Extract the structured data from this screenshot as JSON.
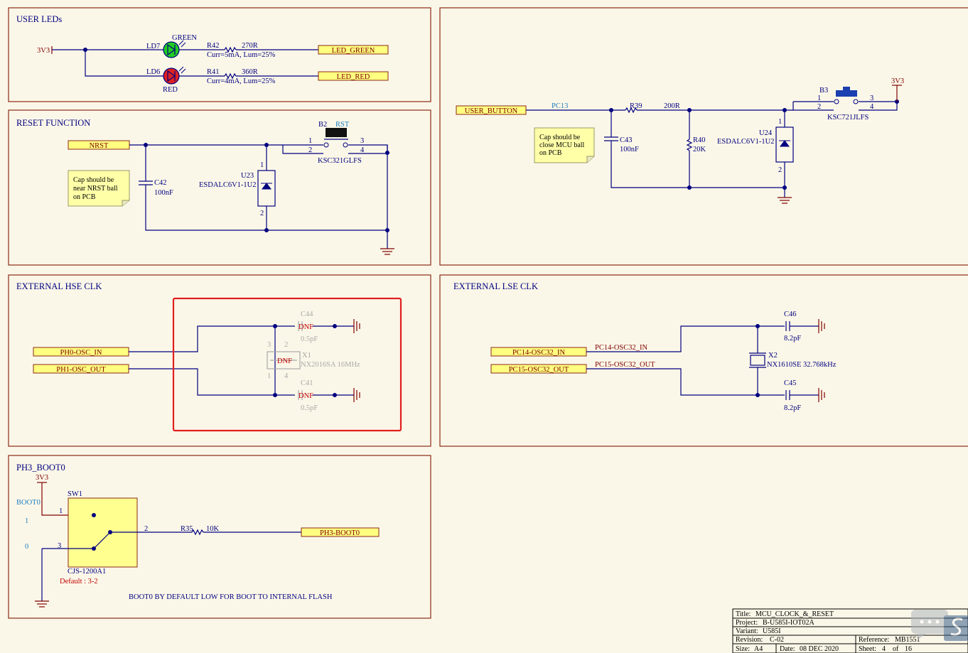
{
  "sections": {
    "user_leds": "USER LEDs",
    "reset_function": "RESET FUNCTION",
    "external_hse": "EXTERNAL HSE CLK",
    "external_lse": "EXTERNAL LSE CLK",
    "ph3_boot0": "PH3_BOOT0"
  },
  "power": {
    "v3v3": "3V3"
  },
  "leds": {
    "ld7": {
      "ref": "LD7",
      "color": "GREEN",
      "res_ref": "R42",
      "res_val": "270R",
      "res_note": "Curr=5mA, Lum=25%",
      "net": "LED_GREEN",
      "fill": "#22cc22"
    },
    "ld6": {
      "ref": "LD6",
      "color": "RED",
      "res_ref": "R41",
      "res_val": "360R",
      "res_note": "Curr=4mA, Lum=25%",
      "net": "LED_RED",
      "fill": "#dd2222"
    }
  },
  "reset": {
    "net": "NRST",
    "note": [
      "Cap should be",
      "near NRST ball",
      "on PCB"
    ],
    "cap_ref": "C42",
    "cap_val": "100nF",
    "tvs_ref": "U23",
    "tvs_val": "ESDALC6V1-1U2",
    "tvs_pin1": "1",
    "tvs_pin2": "2",
    "btn_ref": "B2",
    "btn_label": "RST",
    "btn_val": "KSC321GLFS",
    "p1": "1",
    "p2": "2",
    "p3": "3",
    "p4": "4"
  },
  "user_button": {
    "net": "USER_BUTTON",
    "pin": "PC13",
    "note": [
      "Cap should be",
      "close MCU ball",
      "on PCB"
    ],
    "cap_ref": "C43",
    "cap_val": "100nF",
    "r1_ref": "R39",
    "r1_val": "200R",
    "r2_ref": "R40",
    "r2_val": "20K",
    "tvs_ref": "U24",
    "tvs_val": "ESDALC6V1-1U2",
    "tvs_pin1": "1",
    "tvs_pin2": "2",
    "btn_ref": "B3",
    "btn_val": "KSC721JLFS",
    "p1": "1",
    "p2": "2",
    "p3": "3",
    "p4": "4"
  },
  "hse": {
    "net_in": "PH0-OSC_IN",
    "net_out": "PH1-OSC_OUT",
    "c44_ref": "C44",
    "c44_val": "0.5pF",
    "c41_ref": "C41",
    "c41_val": "0.5pF",
    "dnf": "DNF",
    "x1_ref": "X1",
    "x1_val": "NX2016SA 16MHz",
    "xp1": "1",
    "xp2": "2",
    "xp3": "3",
    "xp4": "4",
    "highlight": "#e02020"
  },
  "lse": {
    "net_in": "PC14-OSC32_IN",
    "net_out": "PC15-OSC32_OUT",
    "c46_ref": "C46",
    "c46_val": "8.2pF",
    "c45_ref": "C45",
    "c45_val": "8.2pF",
    "x2_ref": "X2",
    "x2_val": "NX1610SE 32.768kHz"
  },
  "boot": {
    "boot_label": "BOOT0",
    "one": "1",
    "zero": "0",
    "sw_ref": "SW1",
    "sw_val": "CJS-1200A1",
    "default_note": "Default : 3-2",
    "pin1": "1",
    "pin2": "2",
    "pin3": "3",
    "res_ref": "R35",
    "res_val": "10K",
    "net": "PH3-BOOT0",
    "caption": "BOOT0 BY DEFAULT LOW FOR BOOT TO INTERNAL FLASH"
  },
  "title_block": {
    "title_k": "Title:",
    "title_v": "MCU_CLOCK_&_RESET",
    "project_k": "Project:",
    "project_v": "B-U585I-IOT02A",
    "variant_k": "Variant:",
    "variant_v": "U585I",
    "revision_k": "Revision:",
    "revision_v": "C-02",
    "reference_k": "Reference:",
    "reference_v": "MB1551",
    "size_k": "Size:",
    "size_v": "A4",
    "date_k": "Date:",
    "date_v": "08 DEC 2020",
    "sheet_k": "Sheet:",
    "sheet_v": "4",
    "of_k": "of",
    "of_v": "16"
  }
}
